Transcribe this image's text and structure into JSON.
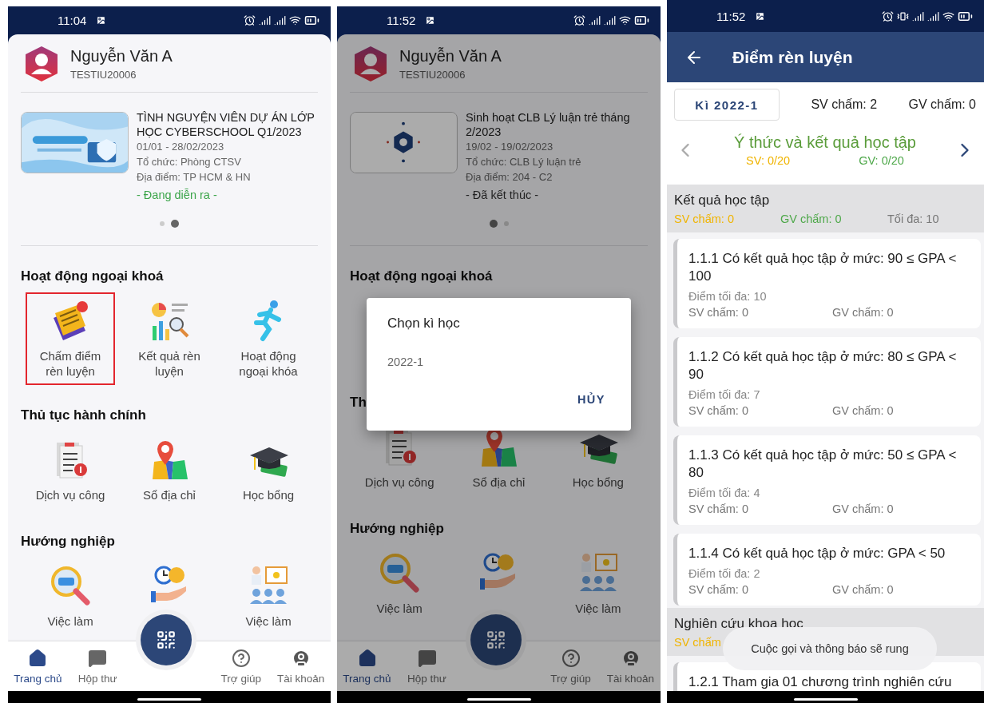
{
  "phones": [
    {
      "kind": "home",
      "status_bar": {
        "time": "11:04",
        "vibrate": false
      },
      "profile": {
        "name": "Nguyễn Văn A",
        "id": "TESTIU20006"
      },
      "event": {
        "title": "TÌNH NGUYỆN VIÊN DỰ ÁN LỚP HỌC CYBERSCHOOL Q1/2023",
        "date": "01/01 - 28/02/2023",
        "organizer": "Tổ chức: Phòng CTSV",
        "place": "Địa điểm: TP HCM & HN",
        "status": "- Đang diễn ra -",
        "ongoing": true
      },
      "pager": [
        {
          "selected": false
        },
        {
          "selected": true
        }
      ],
      "sections": [
        {
          "title": "Hoạt động ngoại khoá",
          "items": [
            {
              "label": "Chấm điểm rèn luyện",
              "highlighted": true
            },
            {
              "label": "Kết quả rèn luyện",
              "highlighted": false
            },
            {
              "label": "Hoạt động ngoại khóa",
              "highlighted": false
            }
          ]
        },
        {
          "title": "Thủ tục hành chính",
          "items": [
            {
              "label": "Dịch vụ công",
              "highlighted": false
            },
            {
              "label": "Sổ địa chỉ",
              "highlighted": false
            },
            {
              "label": "Học bổng",
              "highlighted": false
            }
          ]
        },
        {
          "title": "Hướng nghiệp",
          "items": [
            {
              "label": "Việc làm",
              "highlighted": false
            },
            {
              "highlighted": false
            },
            {
              "label": "Việc làm",
              "highlighted": false
            }
          ]
        }
      ],
      "nav": [
        {
          "label": "Trang chủ",
          "selected": true
        },
        {
          "label": "Hộp thư",
          "selected": false
        },
        {
          "label": "Trợ giúp",
          "selected": false
        },
        {
          "label": "Tài khoản",
          "selected": false
        }
      ]
    },
    {
      "kind": "home",
      "status_bar": {
        "time": "11:52",
        "vibrate": false
      },
      "profile": {
        "name": "Nguyễn Văn A",
        "id": "TESTIU20006"
      },
      "event": {
        "title": "Sinh hoạt CLB Lý luận trẻ tháng 2/2023",
        "date": "19/02 - 19/02/2023",
        "organizer": "Tổ chức: CLB Lý luận trẻ",
        "place": "Địa điểm: 204 - C2",
        "status": "- Đã kết thúc -",
        "ongoing": false
      },
      "pager": [
        {
          "selected": true
        },
        {
          "selected": false
        }
      ],
      "sections": [
        {
          "title": "Hoạt động ngoại khoá"
        },
        {
          "title": "Th",
          "items": [
            {
              "label": "Dịch vụ công",
              "highlighted": false
            },
            {
              "label": "Sổ địa chỉ",
              "highlighted": false
            },
            {
              "label": "Học bổng",
              "highlighted": false
            }
          ]
        },
        {
          "title": "Hướng nghiệp",
          "items": [
            {
              "label": "Việc làm",
              "highlighted": false
            },
            {
              "highlighted": false
            },
            {
              "label": "Việc làm",
              "highlighted": false
            }
          ]
        }
      ],
      "nav": [
        {
          "label": "Trang chủ",
          "selected": true
        },
        {
          "label": "Hộp thư",
          "selected": false
        },
        {
          "label": "Trợ giúp",
          "selected": false
        },
        {
          "label": "Tài khoản",
          "selected": false
        }
      ],
      "dialog": {
        "title": "Chọn kì học",
        "options": [
          "2022-1"
        ],
        "cancel": "HỦY"
      }
    },
    {
      "kind": "score",
      "status_bar": {
        "time": "11:52",
        "vibrate": true
      },
      "app_bar": {
        "title": "Điểm rèn luyện"
      },
      "semester": "Kì 2022-1",
      "sv_total": "SV chấm: 2",
      "gv_total": "GV chấm: 0",
      "category": {
        "title": "Ý thức và kết quả học tập",
        "sv": "SV: 0/20",
        "gv": "GV: 0/20",
        "prev_disabled": true,
        "next_disabled": false
      },
      "groups": [
        {
          "title": "Kết quả học tập",
          "sv": "SV chấm: 0",
          "gv": "GV chấm: 0",
          "max": "Tối đa: 10",
          "criteria": [
            {
              "title": "1.1.1 Có kết quả học tập ở mức: 90 ≤ GPA < 100",
              "max": "Điểm tối đa: 10",
              "sv": "SV chấm: 0",
              "gv": "GV chấm: 0"
            },
            {
              "title": "1.1.2 Có kết quả học tập ở mức: 80 ≤ GPA < 90",
              "max": "Điểm tối đa: 7",
              "sv": "SV chấm: 0",
              "gv": "GV chấm: 0"
            },
            {
              "title": "1.1.3 Có kết quả học tập ở mức: 50 ≤ GPA < 80",
              "max": "Điểm tối đa: 4",
              "sv": "SV chấm: 0",
              "gv": "GV chấm: 0"
            },
            {
              "title": "1.1.4 Có kết quả học tập ở mức: GPA < 50",
              "max": "Điểm tối đa: 2",
              "sv": "SV chấm: 0",
              "gv": "GV chấm: 0"
            }
          ]
        },
        {
          "title": "Nghiên cứu khoa học",
          "sv": "SV chấm",
          "criteria": [
            {
              "title": "1.2.1 Tham gia 01 chương trình nghiên cứu"
            }
          ]
        }
      ],
      "toast": "Cuộc gọi và thông báo sẽ rung"
    }
  ]
}
